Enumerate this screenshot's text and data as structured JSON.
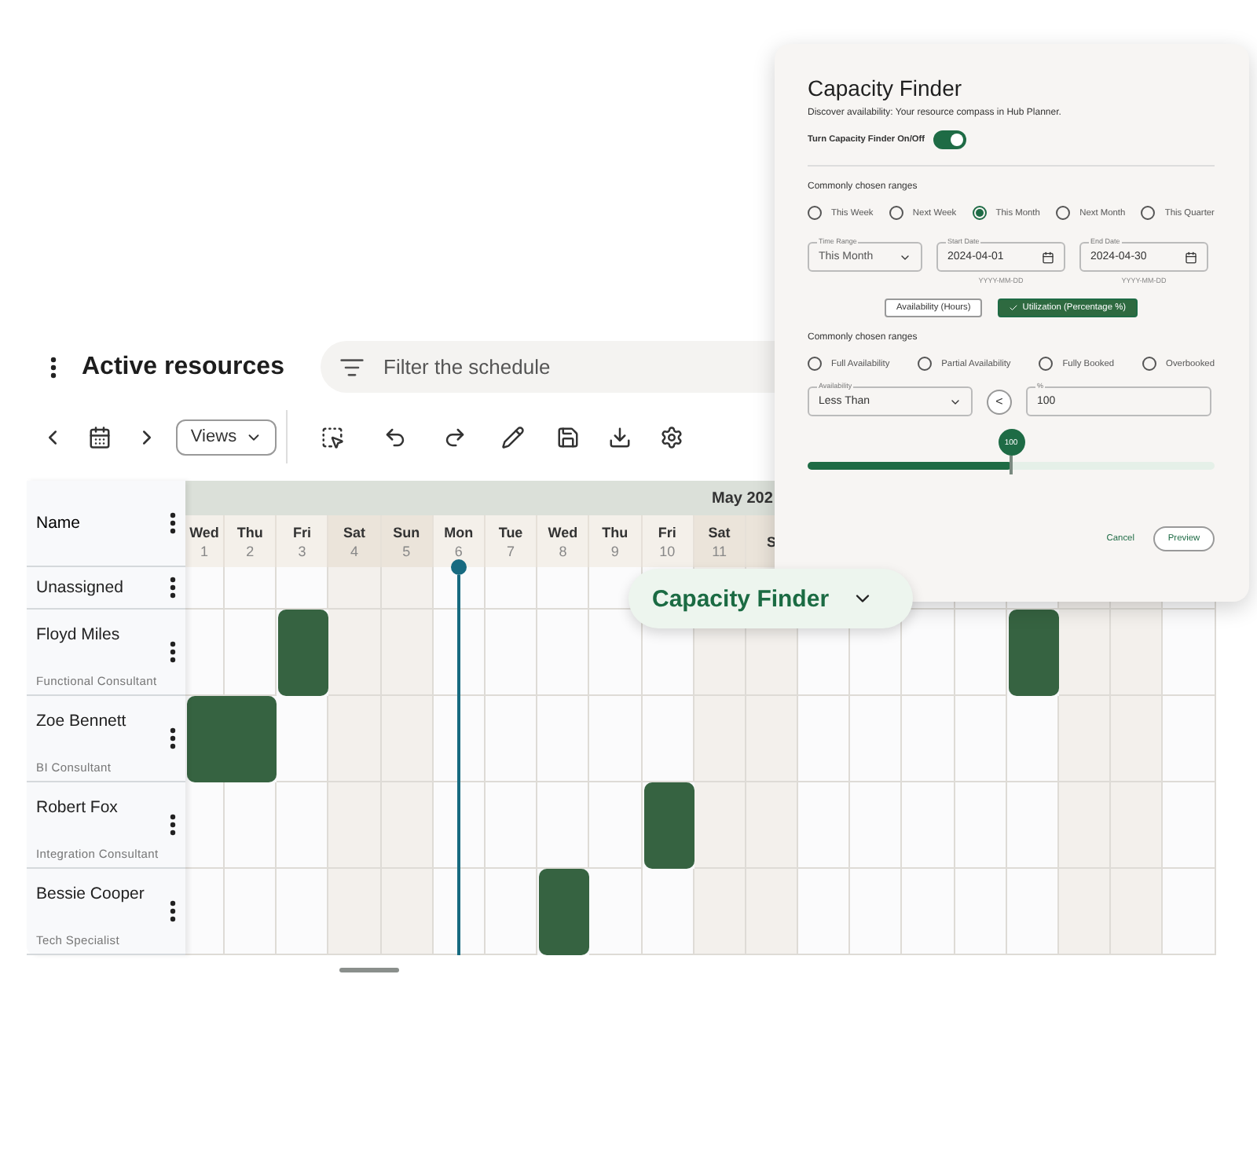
{
  "header": {
    "title": "Active resources",
    "filter_placeholder": "Filter the schedule"
  },
  "toolbar": {
    "views_label": "Views"
  },
  "schedule": {
    "name_header": "Name",
    "month": "May 202",
    "columns": [
      {
        "day": "Wed",
        "date": "1",
        "weekend": false,
        "today": false
      },
      {
        "day": "Thu",
        "date": "2",
        "weekend": false,
        "today": false
      },
      {
        "day": "Fri",
        "date": "3",
        "weekend": false,
        "today": false
      },
      {
        "day": "Sat",
        "date": "4",
        "weekend": true,
        "today": false
      },
      {
        "day": "Sun",
        "date": "5",
        "weekend": true,
        "today": false
      },
      {
        "day": "Mon",
        "date": "6",
        "weekend": false,
        "today": true
      },
      {
        "day": "Tue",
        "date": "7",
        "weekend": false,
        "today": false
      },
      {
        "day": "Wed",
        "date": "8",
        "weekend": false,
        "today": false
      },
      {
        "day": "Thu",
        "date": "9",
        "weekend": false,
        "today": false
      },
      {
        "day": "Fri",
        "date": "10",
        "weekend": false,
        "today": false
      },
      {
        "day": "Sat",
        "date": "11",
        "weekend": true,
        "today": false
      },
      {
        "day": "S",
        "weekend": true,
        "today": false
      },
      {
        "weekend": false,
        "today": false
      },
      {
        "weekend": false,
        "today": false
      },
      {
        "weekend": false,
        "today": false
      },
      {
        "weekend": false,
        "today": false
      },
      {
        "weekend": false,
        "today": false
      },
      {
        "weekend": true,
        "today": false
      },
      {
        "weekend": true,
        "today": false
      },
      {
        "weekend": false,
        "today": false
      }
    ],
    "rows": [
      {
        "name": "Unassigned",
        "booked": [
          false,
          false,
          false,
          false,
          false,
          false,
          false,
          false,
          false,
          false,
          false,
          false
        ]
      },
      {
        "name": "Floyd Miles",
        "role": "Functional Consultant",
        "booked": [
          false,
          false,
          true,
          false,
          false,
          false,
          false,
          false,
          false,
          false,
          false,
          false,
          false,
          false,
          false,
          false,
          true,
          false,
          false,
          false
        ]
      },
      {
        "name": "Zoe Bennett",
        "role": "BI Consultant",
        "booked": [
          true,
          true,
          false,
          false,
          false,
          false,
          false,
          false,
          false,
          false,
          false,
          false,
          false,
          false,
          false,
          false,
          false,
          false,
          false,
          false
        ]
      },
      {
        "name": "Robert Fox",
        "role": "Integration Consultant",
        "booked": [
          false,
          false,
          false,
          false,
          false,
          false,
          false,
          false,
          false,
          true,
          false,
          false,
          false,
          false,
          false,
          false,
          false,
          false,
          false,
          false
        ]
      },
      {
        "name": "Bessie Cooper",
        "role": "Tech Specialist",
        "booked": [
          false,
          false,
          false,
          false,
          false,
          false,
          false,
          true,
          false,
          false,
          false,
          false,
          false,
          false,
          false,
          false,
          false,
          false,
          false,
          false
        ]
      }
    ]
  },
  "capacity_pill": {
    "label": "Capacity Finder"
  },
  "panel": {
    "title": "Capacity Finder",
    "subtitle": "Discover availability: Your resource compass in Hub Planner.",
    "toggle": {
      "label": "Turn Capacity Finder On/Off",
      "on": true
    },
    "ranges_label": "Commonly chosen ranges",
    "ranges": [
      {
        "label": "This Week",
        "selected": false
      },
      {
        "label": "Next Week",
        "selected": false
      },
      {
        "label": "This Month",
        "selected": true
      },
      {
        "label": "Next Month",
        "selected": false
      },
      {
        "label": "This Quarter",
        "selected": false
      }
    ],
    "time_range": {
      "label": "Time Range",
      "value": "This Month"
    },
    "start_date": {
      "label": "Start Date",
      "value": "2024-04-01",
      "helper": "YYYY-MM-DD"
    },
    "end_date": {
      "label": "End Date",
      "value": "2024-04-30",
      "helper": "YYYY-MM-DD"
    },
    "modes": [
      {
        "label": "Availability (Hours)",
        "selected": false
      },
      {
        "label": "Utilization (Percentage %)",
        "selected": true
      }
    ],
    "status_label": "Commonly chosen ranges",
    "statuses": [
      {
        "label": "Full Availability",
        "selected": false
      },
      {
        "label": "Partial Availability",
        "selected": false
      },
      {
        "label": "Fully Booked",
        "selected": false
      },
      {
        "label": "Overbooked",
        "selected": false
      }
    ],
    "comparison": {
      "label": "Availability",
      "value": "Less Than"
    },
    "operator": "<",
    "percent": {
      "label": "%",
      "value": "100"
    },
    "slider": {
      "level": 0.5,
      "reading": "100"
    },
    "cancel": "Cancel",
    "preview": "Preview"
  }
}
